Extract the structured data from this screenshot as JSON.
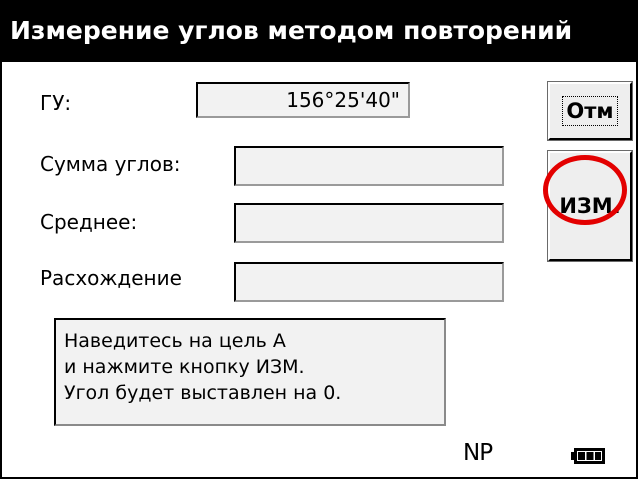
{
  "window": {
    "title": "Измерение углов методом повторений"
  },
  "fields": [
    {
      "label": "ГУ:",
      "value": "156°25'40\""
    },
    {
      "label": "Сумма углов:",
      "value": ""
    },
    {
      "label": "Среднее:",
      "value": ""
    },
    {
      "label": "Расхождение",
      "value": ""
    }
  ],
  "buttons": {
    "cancel_label": "Отм",
    "measure_label": "ИЗМ."
  },
  "message": {
    "lines": [
      "Наведитесь на цель А",
      "и нажмите кнопку ИЗМ.",
      "Угол будет выставлен на 0."
    ]
  },
  "status": {
    "mode": "NP",
    "battery_icon": "battery-full-icon"
  },
  "colors": {
    "titlebar": "#000000",
    "highlight": "#e30000"
  }
}
